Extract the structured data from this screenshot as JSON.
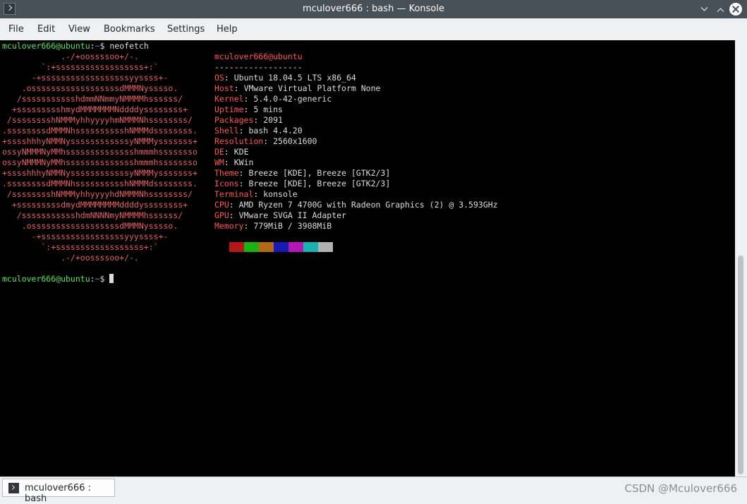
{
  "window": {
    "title": "mculover666 : bash — Konsole"
  },
  "menu": [
    "File",
    "Edit",
    "View",
    "Bookmarks",
    "Settings",
    "Help"
  ],
  "terminal": {
    "prompt_user": "mculover666@ubuntu",
    "prompt_sep": ":",
    "prompt_path": "~",
    "prompt_symbol": "$ ",
    "command": "neofetch",
    "logo_lines": [
      "            .-/+oossssoo+/-.",
      "        `:+ssssssssssssssssss+:`",
      "      -+ssssssssssssssssssyyssss+-",
      "    .ossssssssssssssssssdMMMNysssso.",
      "   /ssssssssssshdmmNNmmyNMMMMhssssss/",
      "  +ssssssssshmydMMMMMMMNddddyssssssss+",
      " /sssssssshNMMMyhhyyyyhmNMMMNhssssssss/",
      ".ssssssssdMMMNhsssssssssshNMMMdssssssss.",
      "+sssshhhyNMMNyssssssssssssyNMMMysssssss+",
      "ossyNMMMNyMMhsssssssssssssshmmmhssssssso",
      "ossyNMMMNyMMhsssssssssssssshmmmhssssssso",
      "+sssshhhyNMMNyssssssssssssyNMMMysssssss+",
      ".ssssssssdMMMNhsssssssssshNMMMdssssssss.",
      " /sssssssshNMMMyhhyyyyhdNMMMNhssssssss/",
      "  +sssssssssdmydMMMMMMMMddddyssssssss+",
      "   /ssssssssssshdmNNNNmyNMMMMhssssss/",
      "    .ossssssssssssssssssdMMMNysssso.",
      "      -+sssssssssssssssssyyyssss+-",
      "        `:+ssssssssssssssssss+:`",
      "            .-/+oossssoo+/-."
    ],
    "info_title": "mculover666@ubuntu",
    "info_underline": "------------------",
    "info": [
      {
        "key": "OS",
        "value": "Ubuntu 18.04.5 LTS x86_64"
      },
      {
        "key": "Host",
        "value": "VMware Virtual Platform None"
      },
      {
        "key": "Kernel",
        "value": "5.4.0-42-generic"
      },
      {
        "key": "Uptime",
        "value": "5 mins"
      },
      {
        "key": "Packages",
        "value": "2091"
      },
      {
        "key": "Shell",
        "value": "bash 4.4.20"
      },
      {
        "key": "Resolution",
        "value": "2560x1600"
      },
      {
        "key": "DE",
        "value": "KDE"
      },
      {
        "key": "WM",
        "value": "KWin"
      },
      {
        "key": "Theme",
        "value": "Breeze [KDE], Breeze [GTK2/3]"
      },
      {
        "key": "Icons",
        "value": "Breeze [KDE], Breeze [GTK2/3]"
      },
      {
        "key": "Terminal",
        "value": "konsole"
      },
      {
        "key": "CPU",
        "value": "AMD Ryzen 7 4700G with Radeon Graphics (2) @ 3.593GHz"
      },
      {
        "key": "GPU",
        "value": "VMware SVGA II Adapter"
      },
      {
        "key": "Memory",
        "value": "779MiB / 3908MiB"
      }
    ],
    "palette": [
      "#b21818",
      "#18b218",
      "#b26818",
      "#1818b2",
      "#b218b2",
      "#18b2b2",
      "#b2b2b2"
    ]
  },
  "tab": {
    "label": "mculover666 : bash"
  },
  "watermark": "CSDN @Mculover666"
}
